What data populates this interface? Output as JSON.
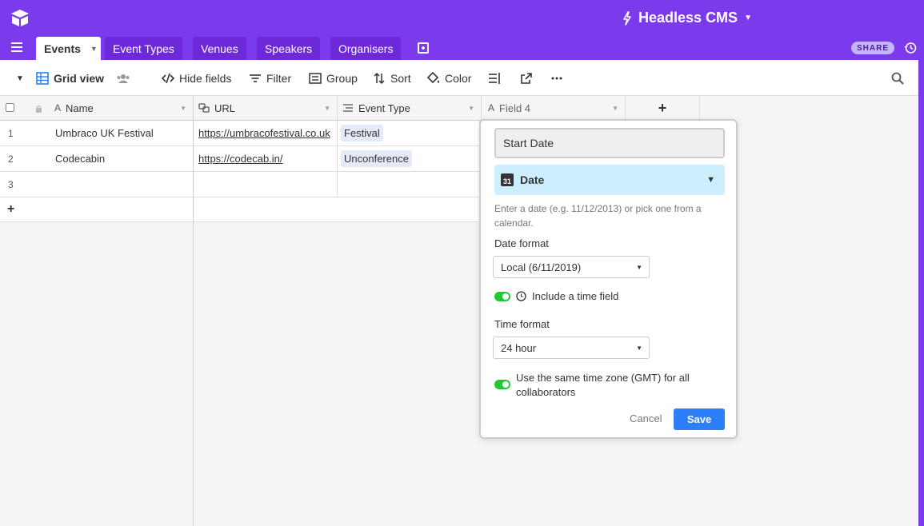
{
  "header": {
    "base_title": "Headless CMS"
  },
  "tabs": [
    {
      "label": "Events"
    },
    {
      "label": "Event Types"
    },
    {
      "label": "Venues"
    },
    {
      "label": "Speakers"
    },
    {
      "label": "Organisers"
    }
  ],
  "share_label": "SHARE",
  "toolbar": {
    "view_name": "Grid view",
    "hide_fields": "Hide fields",
    "filter": "Filter",
    "group": "Group",
    "sort": "Sort",
    "color": "Color"
  },
  "grid": {
    "columns": [
      {
        "label": "Name"
      },
      {
        "label": "URL"
      },
      {
        "label": "Event Type"
      },
      {
        "label": "Field 4"
      }
    ],
    "add_column": "+",
    "add_row": "+",
    "rows": [
      {
        "num": "1",
        "name": "Umbraco UK Festival",
        "url": "https://umbracofestival.co.uk",
        "type": "Festival"
      },
      {
        "num": "2",
        "name": "Codecabin",
        "url": "https://codecab.in/",
        "type": "Unconference"
      },
      {
        "num": "3",
        "name": "",
        "url": "",
        "type": ""
      }
    ]
  },
  "field_editor": {
    "name_value": "Start Date",
    "type_label": "Date",
    "type_icon_text": "31",
    "help_text": "Enter a date (e.g. 11/12/2013) or pick one from a calendar.",
    "date_format_label": "Date format",
    "date_format_value": "Local (6/11/2019)",
    "include_time_label": "Include a time field",
    "include_time_on": true,
    "time_format_label": "Time format",
    "time_format_value": "24 hour",
    "same_timezone_label": "Use the same time zone (GMT) for all collaborators",
    "same_timezone_on": true,
    "cancel_label": "Cancel",
    "save_label": "Save"
  },
  "colors": {
    "brand": "#7c3aed",
    "save_button": "#2d7ff9",
    "toggle_on": "#20c933",
    "type_highlight": "#cdeffd"
  }
}
